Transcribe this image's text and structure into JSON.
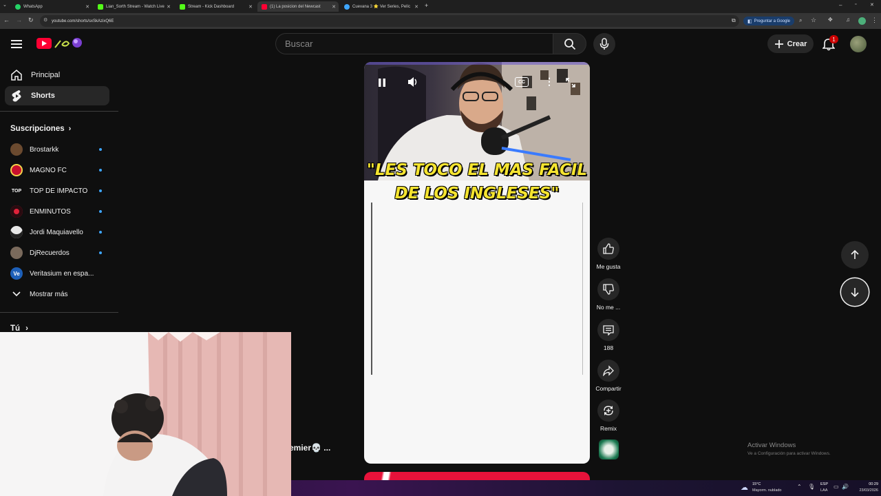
{
  "browser": {
    "tabs": [
      {
        "title": "WhatsApp",
        "color": "#25d366",
        "active": false
      },
      {
        "title": "Lian_Sorth Stream - Watch Live",
        "color": "#53fc18",
        "active": false
      },
      {
        "title": "Stream - Kick Dashboard",
        "color": "#53fc18",
        "active": false
      },
      {
        "title": "(1) La posicion del Newcast",
        "color": "#ff0033",
        "active": true
      },
      {
        "title": "Cuevana 3 ⭐ Ver Series, Pelíc",
        "color": "#3ea6ff",
        "active": false
      }
    ],
    "url": "youtube.com/shorts/sxSkAzixQ6E",
    "ask_google_label": "Preguntar a Google"
  },
  "header": {
    "search_placeholder": "Buscar",
    "create_label": "Crear",
    "notification_count": "1"
  },
  "sidebar": {
    "items": [
      {
        "label": "Principal",
        "icon": "home-icon"
      },
      {
        "label": "Shorts",
        "icon": "shorts-icon",
        "selected": true
      }
    ],
    "subscriptions_title": "Suscripciones",
    "subscriptions": [
      {
        "name": "Brostarkk",
        "avatar_color": "#6b4a2f",
        "mark": ""
      },
      {
        "name": "MAGNO FC",
        "avatar_color": "#c8102e",
        "mark": ""
      },
      {
        "name": "TOP DE IMPACTO",
        "avatar_color": "#0f0f0f",
        "mark": "TOP"
      },
      {
        "name": "ENMINUTOS",
        "avatar_color": "#e0223a",
        "mark": ""
      },
      {
        "name": "Jordi Maquiavello",
        "avatar_color": "#e8e8e8",
        "mark": ""
      },
      {
        "name": "DjRecuerdos",
        "avatar_color": "#7a6a5c",
        "mark": ""
      },
      {
        "name": "Veritasium en espa...",
        "avatar_color": "#1d5fb8",
        "mark": "Ve"
      }
    ],
    "show_more": "Mostrar más",
    "you_label": "Tú"
  },
  "short": {
    "caption_line1": "\"LES TOCO EL MAS FACIL",
    "caption_line2": "DE LOS INGLESES\"",
    "cc_label": "CC",
    "overlay_text": "emier💀 ..."
  },
  "actions": {
    "like": "Me gusta",
    "dislike": "No me ...",
    "comments": "188",
    "share": "Compartir",
    "remix": "Remix"
  },
  "windows": {
    "activate_title": "Activar Windows",
    "activate_sub": "Ve a Configuración para activar Windows.",
    "weather_temp": "15°C",
    "weather_desc": "Mayorm. nublado",
    "lang": "ESP",
    "lang2": "LAA",
    "time": "00:29",
    "date": "23/03/2026"
  },
  "colors": {
    "brand_red": "#ff0033",
    "accent_blue": "#3ea6ff",
    "caption_yellow": "#f5e430"
  }
}
